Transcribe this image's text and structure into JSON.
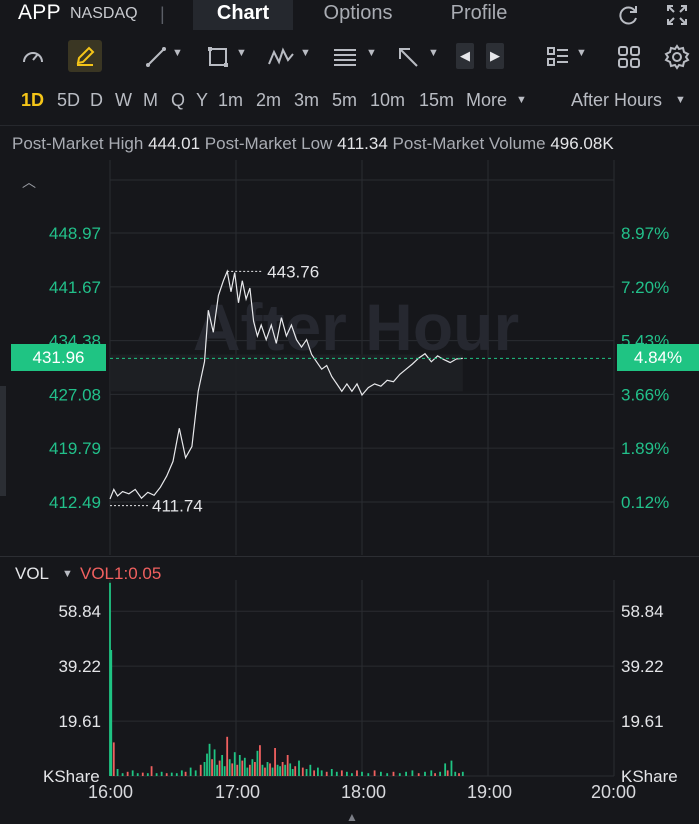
{
  "header": {
    "ticker": "APP",
    "exchange": "NASDAQ",
    "separator": "|",
    "tabs": [
      {
        "label": "Chart",
        "active": true
      },
      {
        "label": "Options",
        "active": false
      },
      {
        "label": "Profile",
        "active": false
      }
    ],
    "icons": [
      "refresh-icon",
      "fullscreen-icon"
    ]
  },
  "toolbar": {
    "icons": [
      "gauge-icon",
      "pen-icon",
      "line-tool-icon",
      "rectangle-tool-icon",
      "pattern-tool-icon",
      "fib-tool-icon",
      "arrow-tool-icon",
      "prev-arrow-icon",
      "next-arrow-icon",
      "indicator-list-icon",
      "layout-grid-icon",
      "settings-icon"
    ],
    "active_color": "#f5c518"
  },
  "timeframes": {
    "items": [
      "1D",
      "5D",
      "D",
      "W",
      "M",
      "Q",
      "Y",
      "1m",
      "2m",
      "3m",
      "5m",
      "10m",
      "15m"
    ],
    "active": "1D",
    "more_label": "More",
    "session_label": "After Hours"
  },
  "stats": {
    "high_label": "Post-Market High",
    "high_value": "444.01",
    "low_label": "Post-Market Low",
    "low_value": "411.34",
    "volume_label": "Post-Market Volume",
    "volume_value": "496.08K"
  },
  "colors": {
    "up": "#1fc483",
    "down": "#f0605f",
    "axis_green": "#22c08a",
    "background": "#16171b",
    "grid": "#2a2c31"
  },
  "chart_data": [
    {
      "type": "line",
      "watermark": "After Hour",
      "xlabel": "",
      "ylabel": "",
      "x_ticks": [
        "16:00",
        "17:00",
        "18:00",
        "19:00",
        "20:00"
      ],
      "x_range_hours": [
        16.0,
        20.0
      ],
      "y_ticks_left": [
        "448.97",
        "441.67",
        "434.38",
        "427.08",
        "419.79",
        "412.49"
      ],
      "y_ticks_right": [
        "8.97%",
        "7.20%",
        "5.43%",
        "3.66%",
        "1.89%",
        "0.12%"
      ],
      "ylim": [
        412.49,
        448.97
      ],
      "current_price": "431.96",
      "current_change": "4.84%",
      "annotations": {
        "high_label": "443.76",
        "low_label": "411.74"
      },
      "series": [
        {
          "color": "#e8e9ec",
          "points": [
            [
              16.0,
              412.9
            ],
            [
              16.03,
              414.2
            ],
            [
              16.06,
              413.3
            ],
            [
              16.1,
              413.9
            ],
            [
              16.15,
              413.6
            ],
            [
              16.2,
              414.2
            ],
            [
              16.25,
              413.0
            ],
            [
              16.3,
              413.8
            ],
            [
              16.35,
              413.4
            ],
            [
              16.4,
              414.5
            ],
            [
              16.45,
              416.0
            ],
            [
              16.5,
              418.0
            ],
            [
              16.55,
              422.5
            ],
            [
              16.6,
              418.5
            ],
            [
              16.65,
              420.0
            ],
            [
              16.7,
              427.5
            ],
            [
              16.75,
              431.5
            ],
            [
              16.78,
              438.5
            ],
            [
              16.82,
              435.5
            ],
            [
              16.86,
              440.5
            ],
            [
              16.9,
              442.5
            ],
            [
              16.93,
              443.76
            ],
            [
              16.96,
              441.0
            ],
            [
              16.99,
              443.6
            ],
            [
              17.02,
              439.5
            ],
            [
              17.05,
              442.5
            ],
            [
              17.08,
              440.0
            ],
            [
              17.11,
              441.5
            ],
            [
              17.14,
              437.0
            ],
            [
              17.17,
              435.0
            ],
            [
              17.2,
              436.5
            ],
            [
              17.24,
              434.5
            ],
            [
              17.28,
              436.5
            ],
            [
              17.32,
              434.0
            ],
            [
              17.36,
              437.5
            ],
            [
              17.4,
              435.0
            ],
            [
              17.44,
              436.5
            ],
            [
              17.48,
              434.5
            ],
            [
              17.52,
              433.5
            ],
            [
              17.56,
              434.5
            ],
            [
              17.6,
              432.5
            ],
            [
              17.64,
              431.5
            ],
            [
              17.68,
              430.5
            ],
            [
              17.72,
              431.0
            ],
            [
              17.76,
              429.5
            ],
            [
              17.8,
              428.5
            ],
            [
              17.84,
              427.5
            ],
            [
              17.88,
              428.5
            ],
            [
              17.92,
              427.5
            ],
            [
              17.96,
              428.5
            ],
            [
              18.0,
              427.0
            ],
            [
              18.05,
              428.0
            ],
            [
              18.1,
              428.5
            ],
            [
              18.15,
              428.2
            ],
            [
              18.2,
              429.0
            ],
            [
              18.25,
              428.8
            ],
            [
              18.3,
              429.8
            ],
            [
              18.35,
              430.5
            ],
            [
              18.4,
              431.2
            ],
            [
              18.45,
              432.0
            ],
            [
              18.5,
              432.6
            ],
            [
              18.55,
              431.5
            ],
            [
              18.6,
              432.3
            ],
            [
              18.65,
              431.8
            ],
            [
              18.7,
              431.4
            ],
            [
              18.75,
              431.9
            ],
            [
              18.8,
              431.96
            ]
          ]
        }
      ]
    },
    {
      "type": "bar",
      "title": "VOL",
      "indicator_label": "VOL1:0.05",
      "y_ticks": [
        "58.84",
        "39.22",
        "19.61"
      ],
      "y_unit_label": "KShare",
      "ylim": [
        0,
        70
      ],
      "x_range_hours": [
        16.0,
        20.0
      ],
      "bars": [
        {
          "t": 16.0,
          "v": 69.0,
          "d": "up"
        },
        {
          "t": 16.01,
          "v": 45.0,
          "d": "up"
        },
        {
          "t": 16.03,
          "v": 12.0,
          "d": "down"
        },
        {
          "t": 16.06,
          "v": 2.5,
          "d": "up"
        },
        {
          "t": 16.1,
          "v": 1.0,
          "d": "up"
        },
        {
          "t": 16.14,
          "v": 1.5,
          "d": "down"
        },
        {
          "t": 16.18,
          "v": 2.0,
          "d": "up"
        },
        {
          "t": 16.22,
          "v": 1.0,
          "d": "up"
        },
        {
          "t": 16.26,
          "v": 1.2,
          "d": "down"
        },
        {
          "t": 16.3,
          "v": 1.0,
          "d": "up"
        },
        {
          "t": 16.33,
          "v": 3.5,
          "d": "down"
        },
        {
          "t": 16.37,
          "v": 1.0,
          "d": "up"
        },
        {
          "t": 16.41,
          "v": 1.5,
          "d": "up"
        },
        {
          "t": 16.45,
          "v": 1.0,
          "d": "down"
        },
        {
          "t": 16.49,
          "v": 1.2,
          "d": "up"
        },
        {
          "t": 16.53,
          "v": 1.0,
          "d": "up"
        },
        {
          "t": 16.57,
          "v": 2.0,
          "d": "up"
        },
        {
          "t": 16.6,
          "v": 1.5,
          "d": "down"
        },
        {
          "t": 16.64,
          "v": 3.0,
          "d": "up"
        },
        {
          "t": 16.68,
          "v": 2.0,
          "d": "up"
        },
        {
          "t": 16.72,
          "v": 4.0,
          "d": "down"
        },
        {
          "t": 16.75,
          "v": 5.0,
          "d": "up"
        },
        {
          "t": 16.77,
          "v": 8.0,
          "d": "up"
        },
        {
          "t": 16.79,
          "v": 11.5,
          "d": "up"
        },
        {
          "t": 16.81,
          "v": 6.0,
          "d": "down"
        },
        {
          "t": 16.83,
          "v": 9.5,
          "d": "up"
        },
        {
          "t": 16.85,
          "v": 4.0,
          "d": "up"
        },
        {
          "t": 16.87,
          "v": 5.5,
          "d": "down"
        },
        {
          "t": 16.89,
          "v": 7.5,
          "d": "up"
        },
        {
          "t": 16.91,
          "v": 3.5,
          "d": "up"
        },
        {
          "t": 16.93,
          "v": 14.0,
          "d": "down"
        },
        {
          "t": 16.95,
          "v": 6.0,
          "d": "up"
        },
        {
          "t": 16.97,
          "v": 4.5,
          "d": "down"
        },
        {
          "t": 16.99,
          "v": 8.5,
          "d": "up"
        },
        {
          "t": 17.01,
          "v": 4.0,
          "d": "down"
        },
        {
          "t": 17.03,
          "v": 7.5,
          "d": "up"
        },
        {
          "t": 17.05,
          "v": 5.5,
          "d": "down"
        },
        {
          "t": 17.07,
          "v": 6.5,
          "d": "up"
        },
        {
          "t": 17.09,
          "v": 3.0,
          "d": "up"
        },
        {
          "t": 17.11,
          "v": 4.0,
          "d": "down"
        },
        {
          "t": 17.13,
          "v": 6.0,
          "d": "up"
        },
        {
          "t": 17.15,
          "v": 5.0,
          "d": "down"
        },
        {
          "t": 17.17,
          "v": 9.0,
          "d": "up"
        },
        {
          "t": 17.19,
          "v": 11.0,
          "d": "down"
        },
        {
          "t": 17.21,
          "v": 4.0,
          "d": "up"
        },
        {
          "t": 17.23,
          "v": 3.0,
          "d": "down"
        },
        {
          "t": 17.25,
          "v": 5.0,
          "d": "up"
        },
        {
          "t": 17.27,
          "v": 4.5,
          "d": "down"
        },
        {
          "t": 17.29,
          "v": 3.0,
          "d": "up"
        },
        {
          "t": 17.31,
          "v": 10.0,
          "d": "down"
        },
        {
          "t": 17.33,
          "v": 4.0,
          "d": "up"
        },
        {
          "t": 17.35,
          "v": 3.5,
          "d": "up"
        },
        {
          "t": 17.37,
          "v": 5.0,
          "d": "down"
        },
        {
          "t": 17.39,
          "v": 4.0,
          "d": "up"
        },
        {
          "t": 17.41,
          "v": 7.5,
          "d": "down"
        },
        {
          "t": 17.43,
          "v": 4.5,
          "d": "up"
        },
        {
          "t": 17.45,
          "v": 2.5,
          "d": "up"
        },
        {
          "t": 17.47,
          "v": 3.5,
          "d": "down"
        },
        {
          "t": 17.5,
          "v": 5.5,
          "d": "up"
        },
        {
          "t": 17.53,
          "v": 3.0,
          "d": "down"
        },
        {
          "t": 17.56,
          "v": 2.5,
          "d": "up"
        },
        {
          "t": 17.59,
          "v": 4.0,
          "d": "up"
        },
        {
          "t": 17.62,
          "v": 2.0,
          "d": "down"
        },
        {
          "t": 17.65,
          "v": 3.0,
          "d": "up"
        },
        {
          "t": 17.68,
          "v": 2.0,
          "d": "up"
        },
        {
          "t": 17.72,
          "v": 1.5,
          "d": "down"
        },
        {
          "t": 17.76,
          "v": 2.5,
          "d": "up"
        },
        {
          "t": 17.8,
          "v": 1.5,
          "d": "up"
        },
        {
          "t": 17.84,
          "v": 2.0,
          "d": "down"
        },
        {
          "t": 17.88,
          "v": 1.5,
          "d": "up"
        },
        {
          "t": 17.92,
          "v": 1.0,
          "d": "up"
        },
        {
          "t": 17.96,
          "v": 2.0,
          "d": "down"
        },
        {
          "t": 18.0,
          "v": 1.5,
          "d": "up"
        },
        {
          "t": 18.05,
          "v": 1.0,
          "d": "up"
        },
        {
          "t": 18.1,
          "v": 2.0,
          "d": "down"
        },
        {
          "t": 18.15,
          "v": 1.5,
          "d": "up"
        },
        {
          "t": 18.2,
          "v": 1.0,
          "d": "up"
        },
        {
          "t": 18.25,
          "v": 1.5,
          "d": "down"
        },
        {
          "t": 18.3,
          "v": 1.0,
          "d": "up"
        },
        {
          "t": 18.35,
          "v": 1.5,
          "d": "up"
        },
        {
          "t": 18.4,
          "v": 2.0,
          "d": "up"
        },
        {
          "t": 18.45,
          "v": 1.0,
          "d": "down"
        },
        {
          "t": 18.5,
          "v": 1.5,
          "d": "up"
        },
        {
          "t": 18.55,
          "v": 2.0,
          "d": "up"
        },
        {
          "t": 18.58,
          "v": 1.0,
          "d": "down"
        },
        {
          "t": 18.62,
          "v": 1.5,
          "d": "up"
        },
        {
          "t": 18.66,
          "v": 4.5,
          "d": "up"
        },
        {
          "t": 18.68,
          "v": 2.0,
          "d": "down"
        },
        {
          "t": 18.71,
          "v": 5.5,
          "d": "up"
        },
        {
          "t": 18.74,
          "v": 1.5,
          "d": "up"
        },
        {
          "t": 18.77,
          "v": 1.0,
          "d": "down"
        },
        {
          "t": 18.8,
          "v": 1.5,
          "d": "up"
        }
      ]
    }
  ]
}
